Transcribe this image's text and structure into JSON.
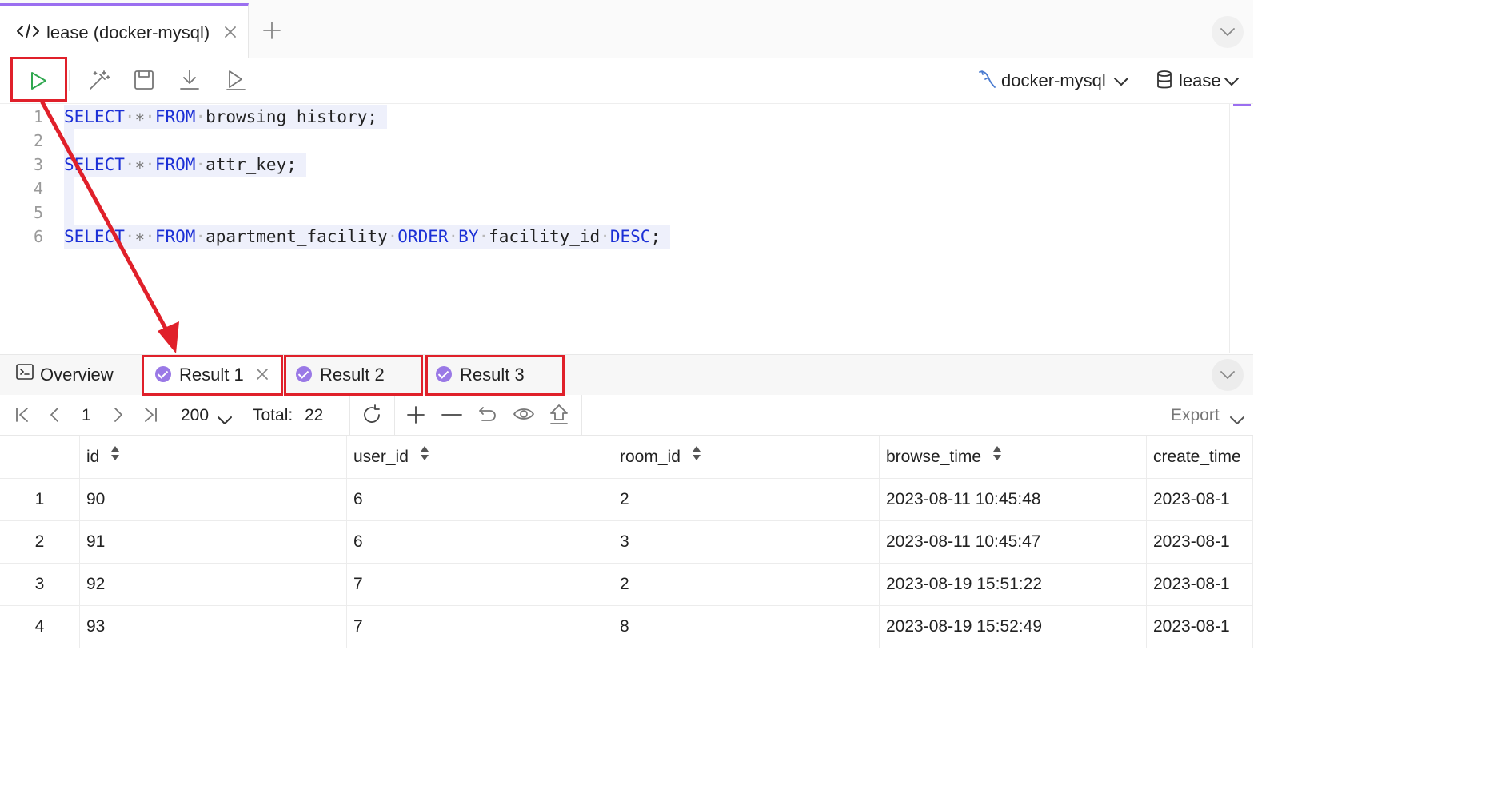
{
  "editor_tab": {
    "title": "lease (docker-mysql)"
  },
  "toolbar": {
    "connection": "docker-mysql",
    "database": "lease"
  },
  "editor": {
    "lines": [
      {
        "n": "1",
        "tokens": [
          [
            "kw",
            "SELECT"
          ],
          [
            "dot",
            "·"
          ],
          [
            "star",
            "∗"
          ],
          [
            "dot",
            "·"
          ],
          [
            "kw",
            "FROM"
          ],
          [
            "dot",
            "·"
          ],
          [
            "tx",
            "browsing_history;"
          ]
        ]
      },
      {
        "n": "2",
        "tokens": []
      },
      {
        "n": "3",
        "tokens": [
          [
            "kw",
            "SELECT"
          ],
          [
            "dot",
            "·"
          ],
          [
            "star",
            "∗"
          ],
          [
            "dot",
            "·"
          ],
          [
            "kw",
            "FROM"
          ],
          [
            "dot",
            "·"
          ],
          [
            "tx",
            "attr_key;"
          ]
        ]
      },
      {
        "n": "4",
        "tokens": []
      },
      {
        "n": "5",
        "tokens": []
      },
      {
        "n": "6",
        "tokens": [
          [
            "kw",
            "SELECT"
          ],
          [
            "dot",
            "·"
          ],
          [
            "star",
            "∗"
          ],
          [
            "dot",
            "·"
          ],
          [
            "kw",
            "FROM"
          ],
          [
            "dot",
            "·"
          ],
          [
            "tx",
            "apartment_facility"
          ],
          [
            "dot",
            "·"
          ],
          [
            "kw",
            "ORDER"
          ],
          [
            "dot",
            "·"
          ],
          [
            "kw",
            "BY"
          ],
          [
            "dot",
            "·"
          ],
          [
            "tx",
            "facility_id"
          ],
          [
            "dot",
            "·"
          ],
          [
            "kw",
            "DESC"
          ],
          [
            "tx",
            ";"
          ]
        ]
      }
    ]
  },
  "results": {
    "overview_label": "Overview",
    "tabs": [
      "Result 1",
      "Result 2",
      "Result 3"
    ]
  },
  "pager": {
    "page": "1",
    "page_size": "200",
    "total_label": "Total:",
    "total": "22",
    "export_label": "Export"
  },
  "table": {
    "columns": [
      "id",
      "user_id",
      "room_id",
      "browse_time",
      "create_time"
    ],
    "rows": [
      {
        "num": "1",
        "cells": [
          "90",
          "6",
          "2",
          "2023-08-11 10:45:48",
          "2023-08-1"
        ]
      },
      {
        "num": "2",
        "cells": [
          "91",
          "6",
          "3",
          "2023-08-11 10:45:47",
          "2023-08-1"
        ]
      },
      {
        "num": "3",
        "cells": [
          "92",
          "7",
          "2",
          "2023-08-19 15:51:22",
          "2023-08-1"
        ]
      },
      {
        "num": "4",
        "cells": [
          "93",
          "7",
          "8",
          "2023-08-19 15:52:49",
          "2023-08-1"
        ]
      }
    ]
  },
  "colors": {
    "accent": "#9b6ff0",
    "keyword": "#1b2fd6",
    "run": "#2fa84f",
    "annotation": "#e0202a",
    "check": "#9a79e6"
  },
  "icons": [
    "code-icon",
    "close-icon",
    "plus-icon",
    "chevron-down-icon",
    "play-icon",
    "magic-wand-icon",
    "save-icon",
    "download-icon",
    "run-selected-icon",
    "mysql-dolphin-icon",
    "database-icon",
    "terminal-icon",
    "check-circle-icon",
    "first-page-icon",
    "prev-page-icon",
    "next-page-icon",
    "last-page-icon",
    "refresh-icon",
    "add-row-icon",
    "delete-row-icon",
    "undo-icon",
    "eye-icon",
    "upload-icon",
    "sort-icon"
  ]
}
